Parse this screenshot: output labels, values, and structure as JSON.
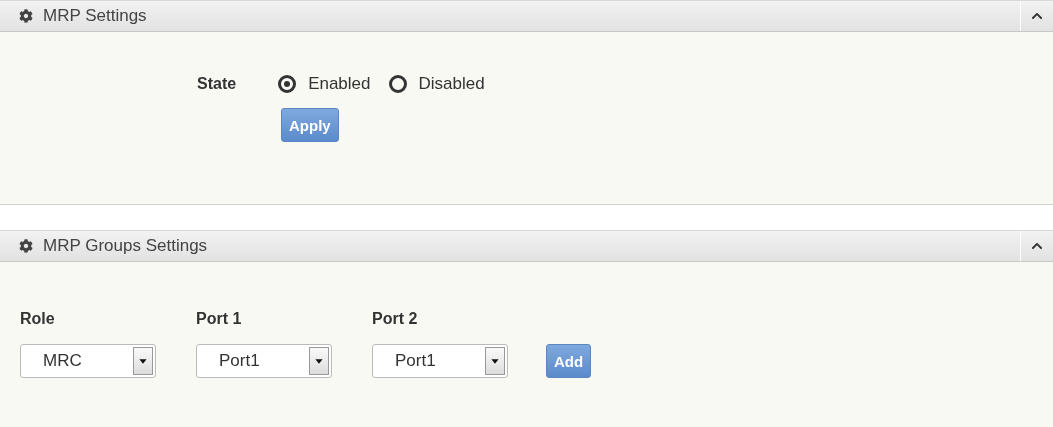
{
  "mrp_settings": {
    "title": "MRP Settings",
    "state": {
      "label": "State",
      "options": [
        {
          "label": "Enabled",
          "selected": true
        },
        {
          "label": "Disabled",
          "selected": false
        }
      ]
    },
    "button": "Apply"
  },
  "mrp_groups_settings": {
    "title": "MRP Groups Settings",
    "fields": [
      {
        "label": "Role",
        "value": "MRC"
      },
      {
        "label": "Port 1",
        "value": "Port1"
      },
      {
        "label": "Port 2",
        "value": "Port1"
      }
    ],
    "button": "Add"
  }
}
